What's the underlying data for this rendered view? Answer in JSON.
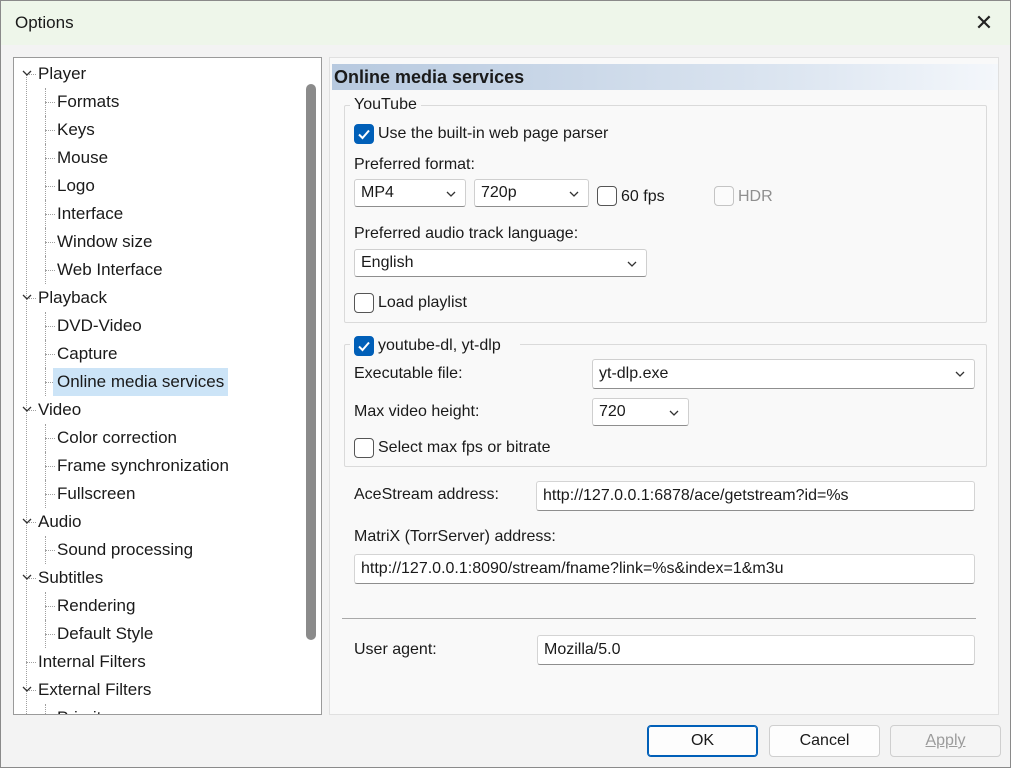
{
  "window": {
    "title": "Options",
    "close_glyph": "✕"
  },
  "tree": {
    "items": [
      {
        "label": "Player",
        "level": 0,
        "expanded": true
      },
      {
        "label": "Formats",
        "level": 1
      },
      {
        "label": "Keys",
        "level": 1
      },
      {
        "label": "Mouse",
        "level": 1
      },
      {
        "label": "Logo",
        "level": 1
      },
      {
        "label": "Interface",
        "level": 1
      },
      {
        "label": "Window size",
        "level": 1
      },
      {
        "label": "Web Interface",
        "level": 1
      },
      {
        "label": "Playback",
        "level": 0,
        "expanded": true
      },
      {
        "label": "DVD-Video",
        "level": 1
      },
      {
        "label": "Capture",
        "level": 1
      },
      {
        "label": "Online media services",
        "level": 1,
        "selected": true
      },
      {
        "label": "Video",
        "level": 0,
        "expanded": true
      },
      {
        "label": "Color correction",
        "level": 1
      },
      {
        "label": "Frame synchronization",
        "level": 1
      },
      {
        "label": "Fullscreen",
        "level": 1
      },
      {
        "label": "Audio",
        "level": 0,
        "expanded": true
      },
      {
        "label": "Sound processing",
        "level": 1
      },
      {
        "label": "Subtitles",
        "level": 0,
        "expanded": true
      },
      {
        "label": "Rendering",
        "level": 1
      },
      {
        "label": "Default Style",
        "level": 1
      },
      {
        "label": "Internal Filters",
        "level": 0
      },
      {
        "label": "External Filters",
        "level": 0,
        "expanded": true
      },
      {
        "label": "Priority",
        "level": 1
      }
    ]
  },
  "page": {
    "title": "Online media services",
    "youtube": {
      "legend": "YouTube",
      "use_parser": {
        "label": "Use the built-in web page parser",
        "checked": true
      },
      "preferred_format_label": "Preferred format:",
      "format": "MP4",
      "resolution": "720p",
      "fps60": {
        "label": "60 fps",
        "checked": false
      },
      "hdr": {
        "label": "HDR",
        "checked": false,
        "enabled": false
      },
      "audio_lang_label": "Preferred audio track language:",
      "audio_lang": "English",
      "load_playlist": {
        "label": "Load playlist",
        "checked": false
      }
    },
    "ytdl": {
      "legend": "youtube-dl, yt-dlp",
      "checked": true,
      "exe_label": "Executable file:",
      "exe_value": "yt-dlp.exe",
      "max_height_label": "Max video height:",
      "max_height_value": "720",
      "max_fps": {
        "label": "Select max fps or bitrate",
        "checked": false
      }
    },
    "acestream": {
      "label": "AceStream address:",
      "value": "http://127.0.0.1:6878/ace/getstream?id=%s"
    },
    "matrix": {
      "label": "MatriX (TorrServer) address:",
      "value": "http://127.0.0.1:8090/stream/fname?link=%s&index=1&m3u"
    },
    "user_agent": {
      "label": "User agent:",
      "value": "Mozilla/5.0"
    }
  },
  "footer": {
    "ok": "OK",
    "cancel": "Cancel",
    "apply": "Apply"
  },
  "colors": {
    "accent": "#005fb8",
    "selection": "#cce4f7",
    "titlebar": "#eef6ea"
  }
}
